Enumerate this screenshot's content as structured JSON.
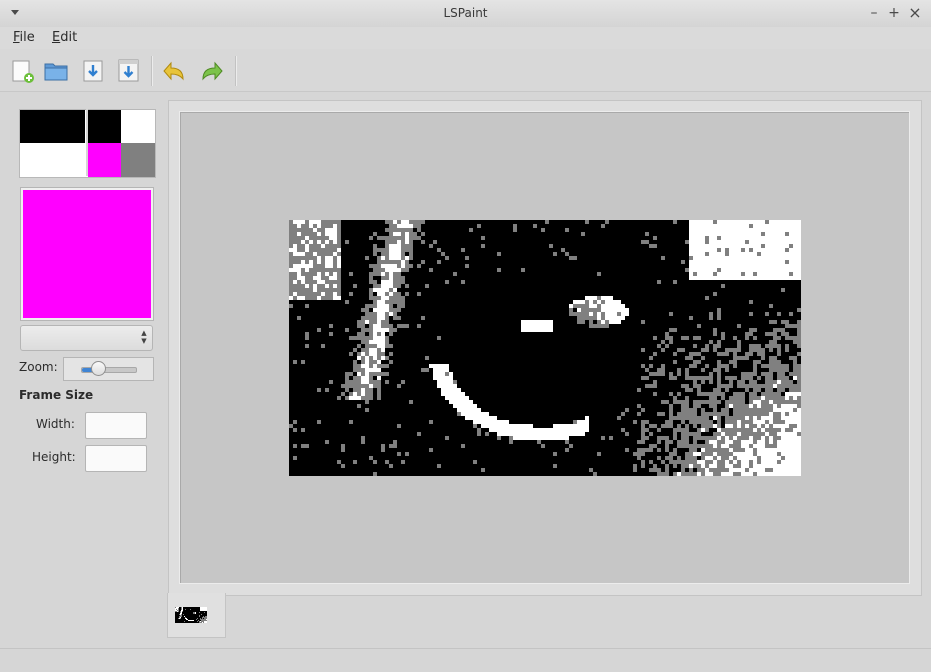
{
  "window": {
    "title": "LSPaint",
    "controls": {
      "minimize": "–",
      "maximize": "+",
      "close": "×"
    }
  },
  "menu": [
    {
      "label": "File",
      "mnemonic": "F",
      "rest": "ile"
    },
    {
      "label": "Edit",
      "mnemonic": "E",
      "rest": "dit"
    }
  ],
  "toolbar": {
    "buttons": [
      "new-file",
      "open-folder",
      "save",
      "save-as",
      "undo",
      "redo"
    ]
  },
  "palette": {
    "colors": [
      "#000000",
      "#ffffff",
      "#ff00ff",
      "#808080"
    ],
    "current_color": "#ff00ff"
  },
  "palette_select": {
    "value": ""
  },
  "zoom": {
    "label": "Zoom:",
    "level": 0.3
  },
  "frame_size": {
    "title": "Frame Size",
    "width_label": "Width:",
    "height_label": "Height:",
    "width_value": "",
    "height_value": ""
  }
}
